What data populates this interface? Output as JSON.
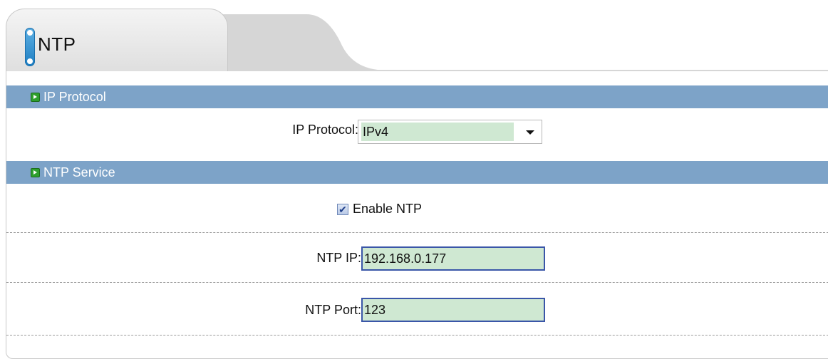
{
  "tab": {
    "title": "NTP"
  },
  "sections": {
    "ip_protocol": {
      "title": "IP Protocol"
    },
    "ntp_service": {
      "title": "NTP Service"
    }
  },
  "fields": {
    "ip_protocol": {
      "label": "IP Protocol:",
      "value": "IPv4"
    },
    "enable_ntp": {
      "label": "Enable NTP",
      "checked": true,
      "check_glyph": "✔"
    },
    "ntp_ip": {
      "label": "NTP IP:",
      "value": "192.168.0.177"
    },
    "ntp_port": {
      "label": "NTP Port:",
      "value": "123"
    }
  },
  "colors": {
    "section_bar": "#7da3c8",
    "input_fill": "#cfe8d2",
    "input_border": "#3a56a8",
    "section_icon": "#2e9f2e"
  },
  "icons": {
    "tab_icon": "tab-pill-icon",
    "section_icon": "green-arrow-icon",
    "dropdown": "chevron-down-icon"
  }
}
